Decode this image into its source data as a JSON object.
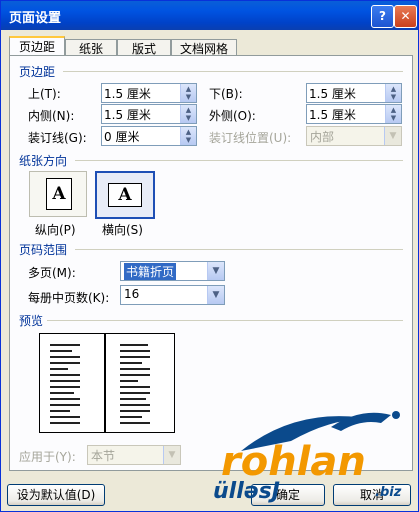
{
  "window": {
    "title": "页面设置",
    "help_glyph": "?",
    "close_glyph": "✕"
  },
  "tabs": [
    "页边距",
    "纸张",
    "版式",
    "文档网格"
  ],
  "margins": {
    "section": "页边距",
    "top_label": "上(T):",
    "top_value": "1.5 厘米",
    "bottom_label": "下(B):",
    "bottom_value": "1.5 厘米",
    "inner_label": "内侧(N):",
    "inner_value": "1.5 厘米",
    "outer_label": "外侧(O):",
    "outer_value": "1.5 厘米",
    "gutter_label": "装订线(G):",
    "gutter_value": "0 厘米",
    "gutter_pos_label": "装订线位置(U):",
    "gutter_pos_value": "内部"
  },
  "orientation": {
    "section": "纸张方向",
    "glyph": "A",
    "portrait": "纵向(P)",
    "landscape": "横向(S)"
  },
  "pages": {
    "section": "页码范围",
    "multiple_label": "多页(M):",
    "multiple_value": "书籍折页",
    "sheets_label": "每册中页数(K):",
    "sheets_value": "16"
  },
  "preview": {
    "section": "预览"
  },
  "apply": {
    "label": "应用于(Y):",
    "value": "本节"
  },
  "buttons": {
    "default": "设为默认值(D)",
    "ok": "确定",
    "cancel": "取消"
  },
  "watermark": {
    "brand": "rohlan",
    "sub": "ülləsJ",
    "tld": ".biz"
  },
  "colors": {
    "accent": "#003399",
    "title_bar": "#0053e1",
    "watermark_orange": "#f39800",
    "watermark_blue": "#0b4a8c"
  }
}
